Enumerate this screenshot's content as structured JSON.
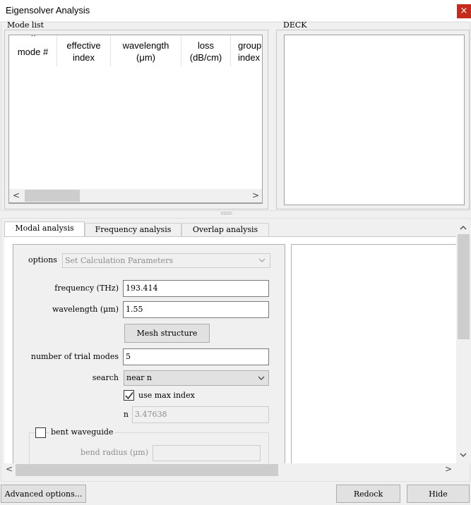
{
  "window": {
    "title": "Eigensolver Analysis",
    "close_glyph": "×"
  },
  "mode_list": {
    "legend": "Mode list",
    "sort_glyph": "^",
    "columns": [
      {
        "line1": "mode #",
        "line2": ""
      },
      {
        "line1": "effective",
        "line2": "index"
      },
      {
        "line1": "wavelength",
        "line2": "(μm)"
      },
      {
        "line1": "loss",
        "line2": "(dB/cm)"
      },
      {
        "line1": "group",
        "line2": "index"
      }
    ],
    "rows": []
  },
  "deck": {
    "legend": "DECK"
  },
  "splitter_glyph": "::::::::::::",
  "tabs": [
    {
      "label": "Modal analysis",
      "active": true
    },
    {
      "label": "Frequency analysis",
      "active": false
    },
    {
      "label": "Overlap analysis",
      "active": false
    }
  ],
  "form": {
    "options_label": "options",
    "options_value": "Set Calculation Parameters",
    "frequency_label": "frequency (THz)",
    "frequency_value": "193.414",
    "wavelength_label": "wavelength (μm)",
    "wavelength_value": "1.55",
    "mesh_button": "Mesh structure",
    "trial_modes_label": "number of trial modes",
    "trial_modes_value": "5",
    "search_label": "search",
    "search_value": "near n",
    "use_max_index_label": "use max index",
    "use_max_index_checked": true,
    "n_label": "n",
    "n_value": "3.47638",
    "bent_waveguide_label": "bent waveguide",
    "bent_waveguide_checked": false,
    "bend_radius_label": "bend radius (μm)",
    "bend_radius_value": ""
  },
  "buttons": {
    "advanced": "Advanced options...",
    "redock": "Redock",
    "hide": "Hide"
  },
  "icons": {
    "close": "close-icon",
    "scroll_left": "arrow-left-icon",
    "scroll_right": "arrow-right-icon",
    "scroll_up": "arrow-up-icon",
    "scroll_down": "arrow-down-icon",
    "dropdown": "chevron-down-icon",
    "check": "checkmark-icon"
  },
  "colors": {
    "close_button": "#c42b1c",
    "window_bg": "#f0f0f0"
  }
}
